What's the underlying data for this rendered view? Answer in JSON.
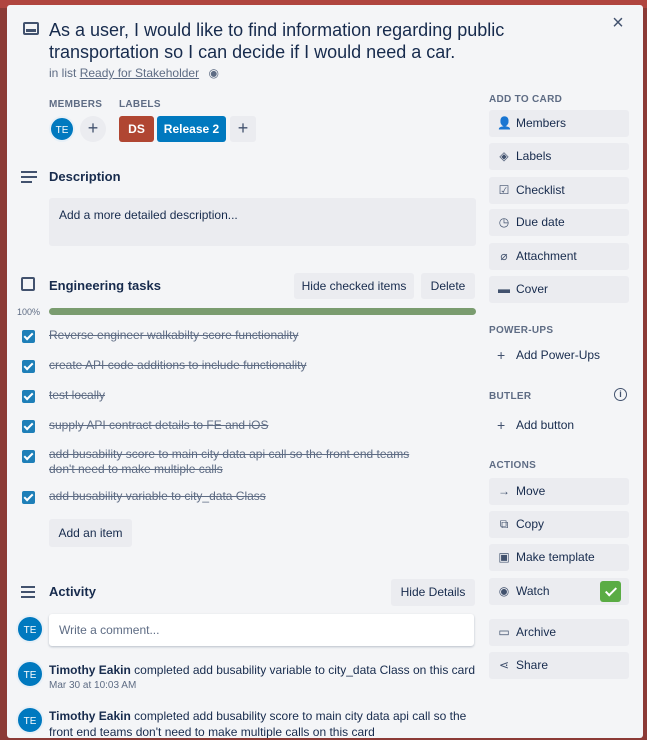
{
  "card": {
    "title": "As a user, I would like to find information regarding public transportation so I can decide if I would need a car.",
    "in_list_prefix": "in list",
    "list_name": "Ready for Stakeholder"
  },
  "members": {
    "heading": "MEMBERS",
    "avatar_initials": "TE",
    "add": "+"
  },
  "labels": {
    "heading": "LABELS",
    "items": [
      {
        "text": "DS",
        "color": "#b04632"
      },
      {
        "text": "Release 2",
        "color": "#0079bf"
      }
    ],
    "add": "+"
  },
  "description": {
    "heading": "Description",
    "placeholder": "Add a more detailed description..."
  },
  "checklist": {
    "heading": "Engineering tasks",
    "hide_checked": "Hide checked items",
    "delete": "Delete",
    "percent_label": "100%",
    "percent_value": 100,
    "items": [
      {
        "text": "Reverse engineer walkabilty score functionality",
        "checked": true
      },
      {
        "text": "create API code additions to include functionality",
        "checked": true
      },
      {
        "text": "test locally",
        "checked": true
      },
      {
        "text": "supply API contract details to FE and iOS",
        "checked": true
      },
      {
        "text": "add busability score to main city data api call so the front end teams don't need to make multiple calls",
        "checked": true
      },
      {
        "text": "add busability variable to city_data Class",
        "checked": true
      }
    ],
    "add_item": "Add an item"
  },
  "activity": {
    "heading": "Activity",
    "hide_details": "Hide Details",
    "comment_placeholder": "Write a comment...",
    "entries": [
      {
        "author": "Timothy Eakin",
        "text": "completed add busability variable to city_data Class on this card",
        "time": "Mar 30 at 10:03 AM"
      },
      {
        "author": "Timothy Eakin",
        "text": "completed add busability score to main city data api call so the front end teams don't need to make multiple calls on this card",
        "time": ""
      }
    ]
  },
  "sidebar": {
    "add_to_card": "ADD TO CARD",
    "add_items": [
      "Members",
      "Labels",
      "Checklist",
      "Due date",
      "Attachment",
      "Cover"
    ],
    "powerups_heading": "POWER-UPS",
    "add_powerups": "Add Power-Ups",
    "butler_heading": "BUTLER",
    "add_button": "Add button",
    "actions_heading": "ACTIONS",
    "actions": [
      "Move",
      "Copy",
      "Make template",
      "Watch",
      "Archive",
      "Share"
    ]
  },
  "close_glyph": "×"
}
